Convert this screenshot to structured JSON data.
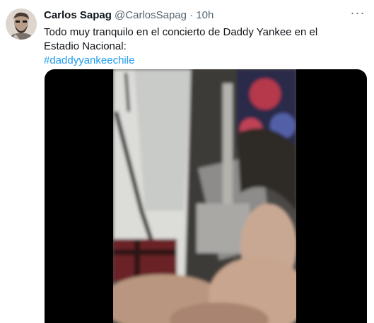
{
  "author": {
    "name": "Carlos Sapag",
    "handle": "@CarlosSapag",
    "separator": "·",
    "time": "10h"
  },
  "tweet": {
    "text": "Todo muy tranquilo en el concierto de Daddy Yankee en el Estadio Nacional:",
    "hashtag": "#daddyyankeechile"
  },
  "more_icon": "more-horizontal-icon",
  "colors": {
    "link": "#1d9bf0",
    "secondary_text": "#536471",
    "primary_text": "#0f1419",
    "media_background": "#000000"
  }
}
